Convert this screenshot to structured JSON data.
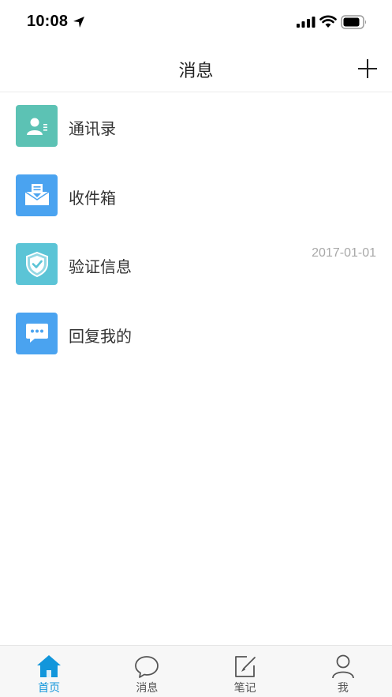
{
  "status_bar": {
    "time": "10:08",
    "icons": [
      "location-arrow-icon",
      "signal-icon",
      "wifi-icon",
      "battery-icon"
    ]
  },
  "nav": {
    "title": "消息",
    "add_icon": "plus-icon"
  },
  "list": {
    "items": [
      {
        "label": "通讯录",
        "date": "",
        "icon": "contacts-icon",
        "color": "#5cc2b4"
      },
      {
        "label": "收件箱",
        "date": "",
        "icon": "inbox-icon",
        "color": "#4aa3f0"
      },
      {
        "label": "验证信息",
        "date": "2017-01-01",
        "icon": "shield-check-icon",
        "color": "#5bc4d6"
      },
      {
        "label": "回复我的",
        "date": "",
        "icon": "chat-bubble-icon",
        "color": "#4aa3f0"
      }
    ]
  },
  "tab_bar": {
    "active_color": "#1296db",
    "tabs": [
      {
        "label": "首页",
        "icon": "home-icon",
        "active": true
      },
      {
        "label": "消息",
        "icon": "message-icon",
        "active": false
      },
      {
        "label": "笔记",
        "icon": "note-edit-icon",
        "active": false
      },
      {
        "label": "我",
        "icon": "user-icon",
        "active": false
      }
    ]
  }
}
